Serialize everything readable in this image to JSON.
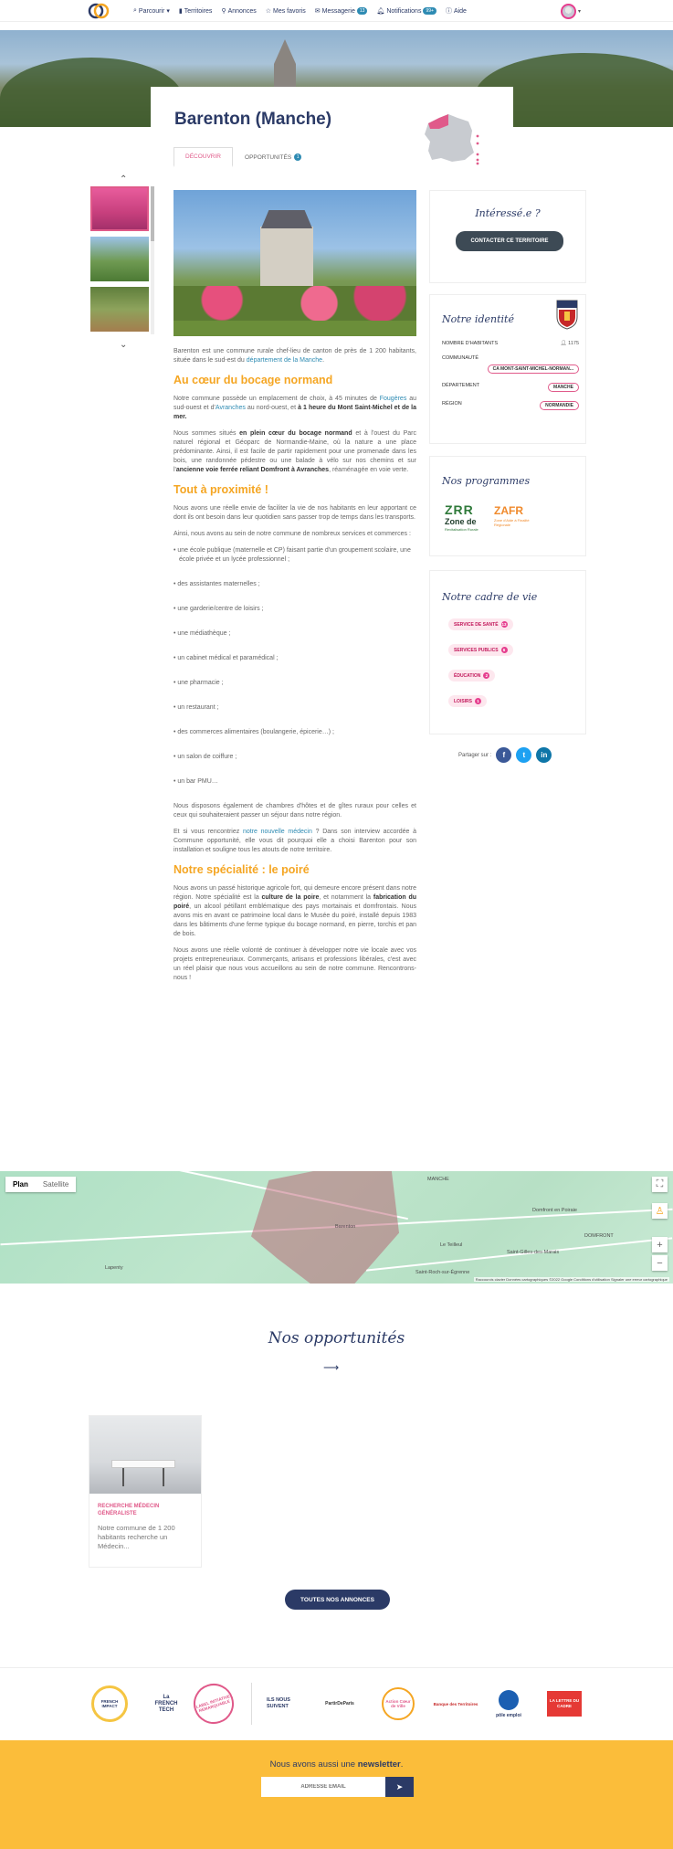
{
  "nav": {
    "items": [
      {
        "label": "Parcourir",
        "icon": "search-icon"
      },
      {
        "label": "Territoires",
        "icon": "book-icon"
      },
      {
        "label": "Annonces",
        "icon": "pin-icon"
      },
      {
        "label": "Mes favoris",
        "icon": "star-icon"
      },
      {
        "label": "Messagerie",
        "icon": "mail-icon",
        "badge": "13"
      },
      {
        "label": "Notifications",
        "icon": "bell-icon",
        "badge": "99+"
      },
      {
        "label": "Aide",
        "icon": "help-icon"
      }
    ]
  },
  "header": {
    "title": "Barenton (Manche)",
    "tabs": [
      {
        "label": "DÉCOUVRIR",
        "active": true
      },
      {
        "label": "OPPORTUNITÉS",
        "badge": "1"
      }
    ]
  },
  "article": {
    "intro_a": "Barenton est une commune rurale chef-lieu de canton de près de 1 200 habitants, située dans le sud-est du ",
    "intro_link": "département de la Manche",
    "intro_b": ".",
    "h1": "Au cœur du bocage normand",
    "p1_a": "Notre commune possède un emplacement de choix, à 45 minutes de ",
    "p1_link1": "Fougères",
    "p1_b": " au sud-ouest et d'",
    "p1_link2": "Avranches",
    "p1_c": " au nord-ouest, et ",
    "p1_bold": "à 1 heure du Mont Saint-Michel et de la mer.",
    "p2_a": "Nous sommes situés ",
    "p2_bold1": "en plein cœur du bocage normand",
    "p2_b": " et à l'ouest du Parc naturel régional et Géoparc de Normandie-Maine, où la nature a une place prédominante. Ainsi, il est facile de partir rapidement pour une promenade dans les bois, une randonnée pédestre ou une balade à vélo sur nos chemins et sur l'",
    "p2_bold2": "ancienne voie ferrée reliant Domfront à Avranches",
    "p2_c": ", réaménagée en voie verte.",
    "h2": "Tout à proximité !",
    "p3": "Nous avons une réelle envie de faciliter la vie de nos habitants en leur apportant ce dont ils ont besoin dans leur quotidien sans passer trop de temps dans les transports.",
    "p4": "Ainsi, nous avons au sein de notre commune de nombreux services et commerces :",
    "list": [
      "• une école publique (maternelle et CP) faisant partie d'un groupement scolaire, une école privée et un lycée professionnel ;",
      "• des assistantes maternelles ;",
      "• une garderie/centre de loisirs ;",
      "• une médiathèque ;",
      "• un cabinet médical et paramédical ;",
      "• une pharmacie ;",
      "• un restaurant ;",
      "• des commerces alimentaires (boulangerie, épicerie…) ;",
      "• un salon de coiffure ;",
      "• un bar PMU…"
    ],
    "p5": "Nous disposons également de chambres d'hôtes et de gîtes ruraux pour celles et ceux qui souhaiteraient passer un séjour dans notre région.",
    "p6_a": "Et si vous rencontriez ",
    "p6_link": "notre nouvelle médecin",
    "p6_b": " ? Dans son interview accordée à Commune opportunité, elle vous dit pourquoi elle a choisi Barenton pour son installation et souligne tous les atouts de notre territoire.",
    "h3": "Notre spécialité : le poiré",
    "p7_a": "Nous avons un passé historique agricole fort, qui demeure encore présent dans notre région. Notre spécialité est la ",
    "p7_bold1": "culture de la poire",
    "p7_b": ", et notamment la ",
    "p7_bold2": "fabrication du poiré",
    "p7_c": ", un alcool pétillant emblématique des pays mortainais et domfrontais. Nous avons mis en avant ce patrimoine local dans le Musée du poiré, installé depuis 1983 dans les bâtiments d'une ferme typique du bocage normand, en pierre, torchis et pan de bois.",
    "p8": "Nous avons une réelle volonté de continuer à développer notre vie locale avec vos projets entrepreneuriaux. Commerçants, artisans et professions libérales, c'est avec un réel plaisir que nous vous accueillons au sein de notre commune. Rencontrons-nous !"
  },
  "sidebar": {
    "interest": {
      "title": "Intéressé.e ?",
      "button": "CONTACTER CE TERRITOIRE"
    },
    "identity": {
      "title": "Notre identité",
      "inhabitants_label": "NOMBRE D'HABITANTS",
      "inhabitants_value": "1175",
      "community_label": "COMMUNAUTÉ",
      "community_value": "CA MONT-SAINT-MICHEL-NORMAN...",
      "department_label": "DÉPARTEMENT",
      "department_value": "MANCHE",
      "region_label": "RÉGION",
      "region_value": "NORMANDIE"
    },
    "programs": {
      "title": "Nos programmes",
      "zrr": "ZRR",
      "zrr_sub": "Zone de",
      "zrr_sub2": "Revitalisation Rurale",
      "zafr": "ZAFR",
      "zafr_sub": "Zone d'Aide à Finalité Régionale"
    },
    "life": {
      "title": "Notre cadre de vie",
      "items": [
        {
          "label": "SERVICE DE SANTÉ",
          "count": "13"
        },
        {
          "label": "SERVICES PUBLICS",
          "count": "6"
        },
        {
          "label": "ÉDUCATION",
          "count": "2"
        },
        {
          "label": "LOISIRS",
          "count": "1"
        }
      ]
    },
    "share_label": "Partager sur :"
  },
  "map": {
    "tab_plan": "Plan",
    "tab_satellite": "Satellite",
    "labels": [
      "Lapenty",
      "Barenton",
      "MANCHE",
      "Domfront en Poiraie",
      "DOMFRONT",
      "Saint-Roch-sur-Égrenne",
      "Saint-Gilles-des-Marais",
      "Le Teilleul"
    ],
    "footer": "Raccourcis clavier   Données cartographiques ©2022 Google   Conditions d'utilisation   Signaler une erreur cartographique"
  },
  "opportunities": {
    "title": "Nos opportunités",
    "card_category": "RECHERCHE MÉDECIN GÉNÉRALISTE",
    "card_desc": "Notre commune de 1 200 habitants recherche un Médecin...",
    "all_button": "TOUTES NOS ANNONCES"
  },
  "partners": {
    "frenchimpact": "FRENCH IMPACT",
    "frenchtech": "La FRENCH TECH",
    "label": "LABEL INITIATIVE REMARQUABLE",
    "ils": "ILS NOUS SUIVENT",
    "partner5": "PartirDeParis",
    "coeur": "Action Cœur de Ville",
    "partner7": "Banque des Territoires",
    "pole": "pôle emploi",
    "cadre": "LA LETTRE DU CADRE"
  },
  "newsletter": {
    "text_a": "Nous avons aussi une ",
    "text_bold": "newsletter",
    "text_b": ".",
    "placeholder": "ADRESSE EMAIL"
  },
  "colors": {
    "navy": "#2b3a66",
    "pink": "#e05a8a",
    "orange": "#f5a623",
    "yellow": "#fbbd3a"
  }
}
